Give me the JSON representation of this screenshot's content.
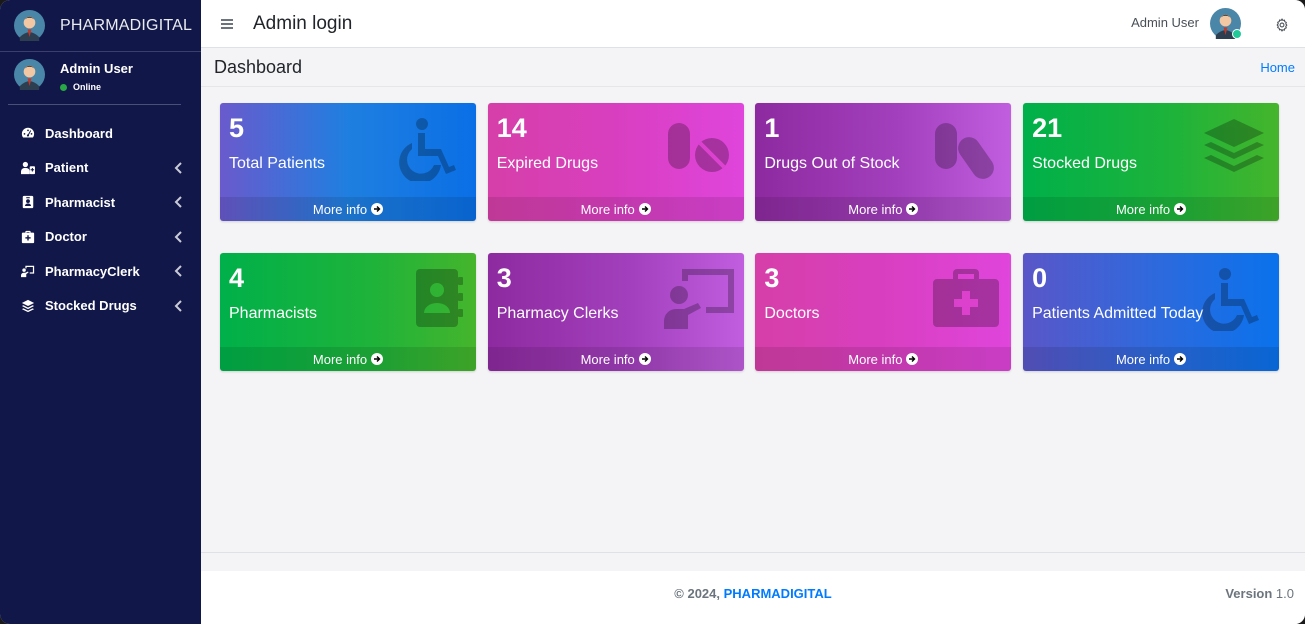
{
  "sidebar": {
    "brand": "PHARMADIGITAL",
    "user_name": "Admin User",
    "user_status": "Online",
    "items": [
      {
        "label": "Dashboard",
        "icon": "tachometer-icon",
        "has_children": false
      },
      {
        "label": "Patient",
        "icon": "user-injured-icon",
        "has_children": true
      },
      {
        "label": "Pharmacist",
        "icon": "id-badge-icon",
        "has_children": true
      },
      {
        "label": "Doctor",
        "icon": "medkit-icon",
        "has_children": true
      },
      {
        "label": "PharmacyClerk",
        "icon": "chalkboard-teacher-icon",
        "has_children": true
      },
      {
        "label": "Stocked Drugs",
        "icon": "layer-group-icon",
        "has_children": true
      }
    ]
  },
  "header": {
    "title": "Admin login",
    "user_name": "Admin User"
  },
  "content_header": {
    "title": "Dashboard",
    "breadcrumb": "Home"
  },
  "cards": [
    {
      "value": "5",
      "label": "Total Patients",
      "icon": "wheelchair-icon",
      "link": "More info",
      "color": "#1f7fe0"
    },
    {
      "value": "14",
      "label": "Expired Drugs",
      "icon": "pills-icon",
      "link": "More info",
      "color": "#d83fc0"
    },
    {
      "value": "1",
      "label": "Drugs Out of Stock",
      "icon": "capsules-icon",
      "link": "More info",
      "color": "#a23fbc"
    },
    {
      "value": "21",
      "label": "Stocked Drugs",
      "icon": "layer-group-icon",
      "link": "More info",
      "color": "#00b04a"
    },
    {
      "value": "4",
      "label": "Pharmacists",
      "icon": "address-book-icon",
      "link": "More info",
      "color": "#1fb33a"
    },
    {
      "value": "3",
      "label": "Pharmacy Clerks",
      "icon": "chalkboard-teacher-icon",
      "link": "More info",
      "color": "#a23fbc"
    },
    {
      "value": "3",
      "label": "Doctors",
      "icon": "medkit-icon",
      "link": "More info",
      "color": "#d83fc0"
    },
    {
      "value": "0",
      "label": "Patients Admitted Today",
      "icon": "wheelchair-icon",
      "link": "More info",
      "color": "#2f69dc"
    }
  ],
  "footer": {
    "copyright": "© 2024, ",
    "brand": "PHARMADIGITAL",
    "version_label": "Version",
    "version_value": " 1.0"
  },
  "colors": {
    "sidebar_bg": "#121749",
    "accent": "#007bff",
    "online": "#28a745"
  }
}
